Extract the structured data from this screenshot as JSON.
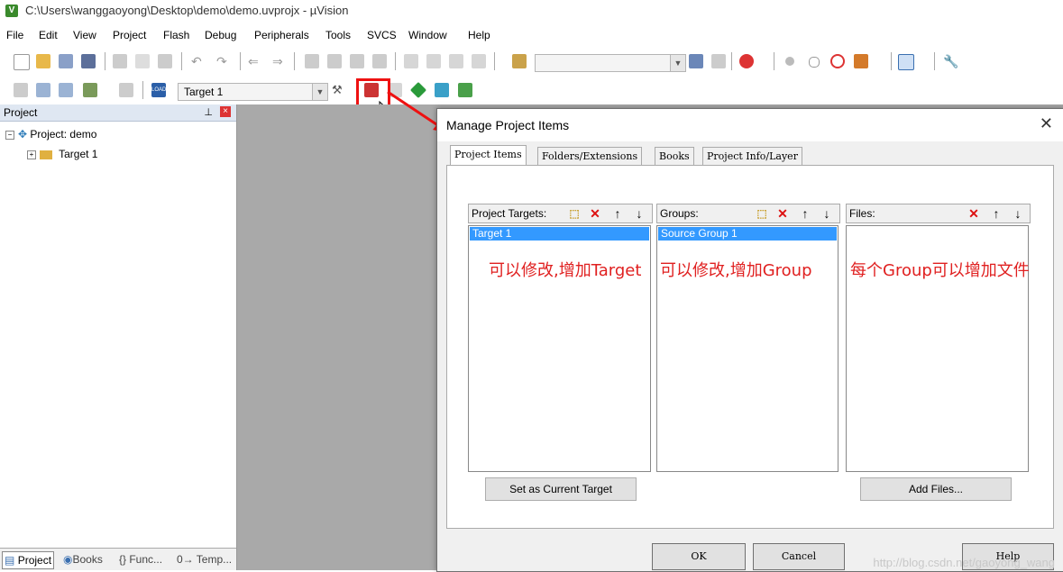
{
  "window": {
    "title": "C:\\Users\\wanggaoyong\\Desktop\\demo\\demo.uvprojx - µVision"
  },
  "menu": [
    "File",
    "Edit",
    "View",
    "Project",
    "Flash",
    "Debug",
    "Peripherals",
    "Tools",
    "SVCS",
    "Window",
    "Help"
  ],
  "toolbar2": {
    "target_select": "Target 1"
  },
  "project_panel": {
    "title": "Project",
    "root": "Project: demo",
    "child": "Target 1",
    "tabs": [
      "Project",
      "Books",
      "{} Func...",
      "0→ Temp..."
    ]
  },
  "dialog": {
    "title": "Manage Project Items",
    "tabs": [
      "Project Items",
      "Folders/Extensions",
      "Books",
      "Project Info/Layer"
    ],
    "targets": {
      "label": "Project Targets:",
      "selected": "Target 1",
      "note": "可以修改,增加Target",
      "button": "Set as Current Target"
    },
    "groups": {
      "label": "Groups:",
      "selected": "Source Group 1",
      "note": "可以修改,增加Group"
    },
    "files": {
      "label": "Files:",
      "note": "每个Group可以增加文件",
      "button": "Add Files..."
    },
    "buttons": {
      "ok": "OK",
      "cancel": "Cancel",
      "help": "Help"
    },
    "watermark": "http://blog.csdn.net/gaoyong_wang"
  },
  "colors": {
    "selection": "#3399ff",
    "annotation": "#e02020",
    "workspace": "#a9a9a9"
  }
}
